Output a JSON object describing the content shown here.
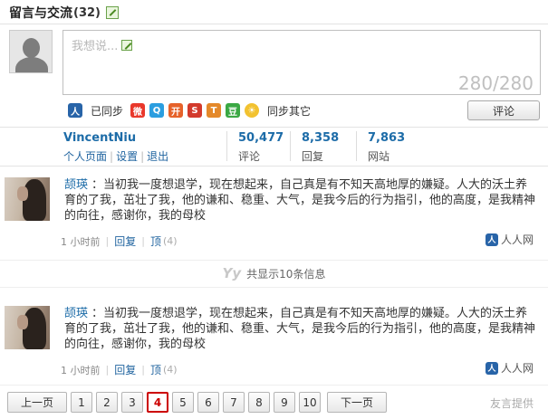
{
  "header": {
    "title": "留言与交流",
    "count": "(32)"
  },
  "compose": {
    "placeholder": "我想说...",
    "counter": "280/280"
  },
  "share": {
    "synced_label": "已同步",
    "sync_other_label": "同步其它",
    "icons": [
      {
        "name": "weibo-icon",
        "glyph": "微",
        "color": "#e9382b"
      },
      {
        "name": "qzone-icon",
        "glyph": "Q",
        "color": "#2b9ee0"
      },
      {
        "name": "kaixin-icon",
        "glyph": "开",
        "color": "#e6622a"
      },
      {
        "name": "sohu-icon",
        "glyph": "S",
        "color": "#d33a2c"
      },
      {
        "name": "tianya-icon",
        "glyph": "T",
        "color": "#e4892a"
      },
      {
        "name": "douban-icon",
        "glyph": "豆",
        "color": "#3aa843"
      }
    ],
    "sync_other_icon": "sun-icon"
  },
  "actions": {
    "comment_button": "评论"
  },
  "user": {
    "name": "VincentNiu",
    "links": [
      "个人页面",
      "设置",
      "退出"
    ]
  },
  "stats": [
    {
      "value": "50,477",
      "label": "评论"
    },
    {
      "value": "8,358",
      "label": "回复"
    },
    {
      "value": "7,863",
      "label": "网站"
    }
  ],
  "posts": [
    {
      "author": "颉瑛",
      "text": "：当初我一度想退学，现在想起来，自己真是有不知天高地厚的嫌疑。人大的沃土养育的了我，茁壮了我，他的谦和、稳重、大气，是我今后的行为指引，他的高度，是我精神的向往，感谢你，我的母校",
      "time": "1 小时前",
      "reply": "回复",
      "top": "顶",
      "top_count": "(4)",
      "source": "人人网"
    },
    {
      "author": "颉瑛",
      "text": "：当初我一度想退学，现在想起来，自己真是有不知天高地厚的嫌疑。人大的沃土养育的了我，茁壮了我，他的谦和、稳重、大气，是我今后的行为指引，他的高度，是我精神的向往，感谢你，我的母校",
      "time": "1 小时前",
      "reply": "回复",
      "top": "顶",
      "top_count": "(4)",
      "source": "人人网"
    }
  ],
  "total_line": {
    "logo": "Yy",
    "text": "共显示10条信息"
  },
  "pagination": {
    "prev": "上一页",
    "next": "下一页",
    "pages": [
      "1",
      "2",
      "3",
      "4",
      "5",
      "6",
      "7",
      "8",
      "9",
      "10"
    ],
    "current": "4"
  },
  "footer": {
    "provider": "友言提供"
  },
  "colors": {
    "link": "#1d6ca8",
    "current_page": "#cc0000",
    "renren": "#2864a8"
  }
}
